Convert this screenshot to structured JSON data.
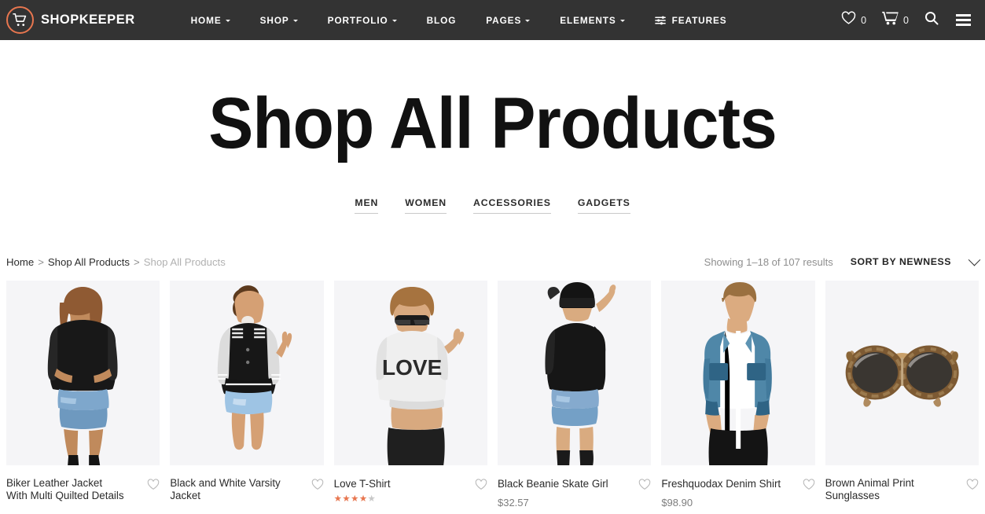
{
  "header": {
    "logo_icon": "shopping-cart-icon",
    "brand": "SHOPKEEPER",
    "nav": [
      {
        "label": "HOME",
        "caret": true
      },
      {
        "label": "SHOP",
        "caret": true
      },
      {
        "label": "PORTFOLIO",
        "caret": true
      },
      {
        "label": "BLOG",
        "caret": false
      },
      {
        "label": "PAGES",
        "caret": true
      },
      {
        "label": "ELEMENTS",
        "caret": true
      },
      {
        "label": "FEATURES",
        "caret": false,
        "icon": "sliders-icon"
      }
    ],
    "wishlist_count": "0",
    "cart_count": "0",
    "search_icon": "search-icon",
    "menu_icon": "hamburger-icon"
  },
  "hero": {
    "title": "Shop All Products",
    "categories": [
      {
        "label": "MEN"
      },
      {
        "label": "WOMEN"
      },
      {
        "label": "ACCESSORIES"
      },
      {
        "label": "GADGETS"
      }
    ]
  },
  "toolbar": {
    "breadcrumb": [
      {
        "label": "Home",
        "current": false
      },
      {
        "label": "Shop All Products",
        "current": false
      },
      {
        "label": "Shop All Products",
        "current": true
      }
    ],
    "separator": ">",
    "showing": "Showing 1–18 of 107 results",
    "sort_label": "SORT BY NEWNESS"
  },
  "products": [
    {
      "title": "Biker Leather Jacket With Multi Quilted Details",
      "price": "",
      "rating": 0,
      "image": "woman-black-leather-jacket-denim-shorts"
    },
    {
      "title": "Black and White Varsity Jacket",
      "price": "",
      "rating": 0,
      "image": "woman-varsity-jacket-bubblegum"
    },
    {
      "title": "Love T-Shirt",
      "price": "",
      "rating": 4,
      "image": "woman-love-crop-top-sunglasses"
    },
    {
      "title": "Black Beanie Skate Girl",
      "price": "$32.57",
      "rating": 0,
      "image": "woman-black-beanie-denim-shorts"
    },
    {
      "title": "Freshquodax Denim Shirt",
      "price": "$98.90",
      "rating": 0,
      "image": "man-blue-denim-shirt"
    },
    {
      "title": "Brown Animal Print Sunglasses",
      "price": "",
      "rating": 0,
      "image": "brown-tortoise-sunglasses"
    }
  ],
  "colors": {
    "header_bg": "#333333",
    "accent": "#e8764f",
    "text": "#2b2b2b",
    "muted": "#8e8e8e",
    "thumb_bg": "#f5f5f7"
  },
  "icons": {
    "heart": "heart-outline-icon",
    "star_filled": "★",
    "star_empty": "★"
  }
}
